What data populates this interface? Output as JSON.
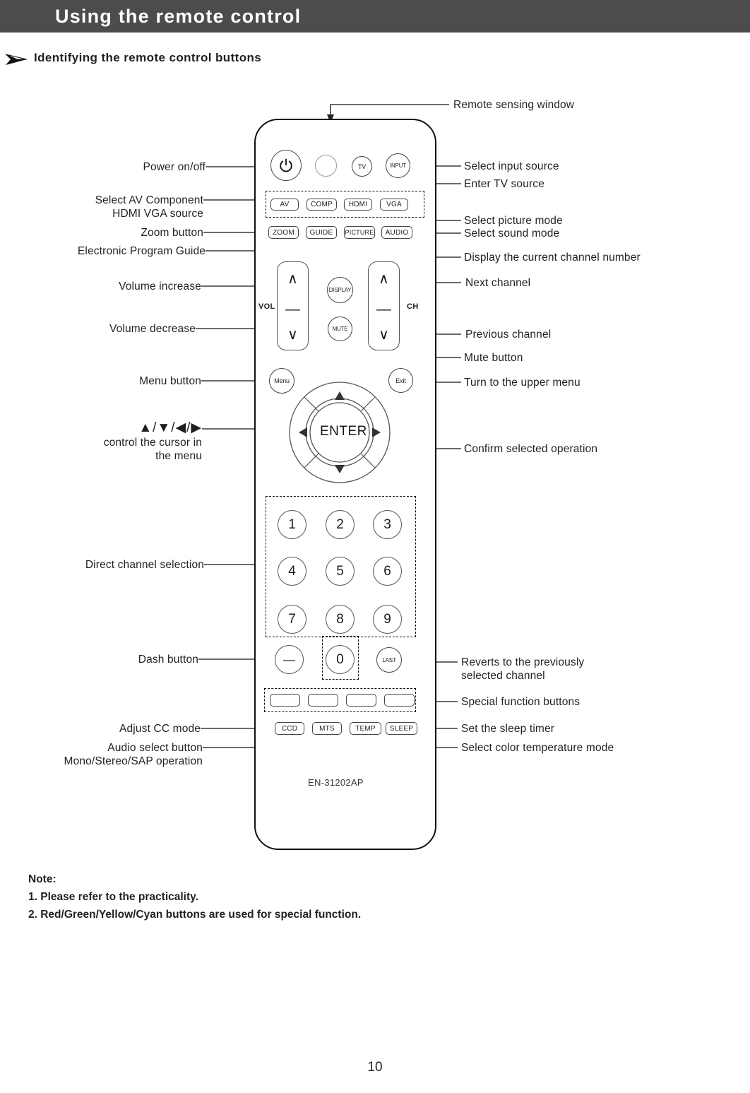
{
  "header": {
    "title": "Using the remote control"
  },
  "section": {
    "arrow_icon": "arrowhead-icon",
    "heading": "Identifying the remote control buttons"
  },
  "remote": {
    "model": "EN-31202AP",
    "top_buttons": [
      {
        "name": "power-button",
        "label": "⏻",
        "icon": "power-icon"
      },
      {
        "name": "led-indicator",
        "label": "",
        "icon": "led-icon"
      },
      {
        "name": "tv-button",
        "label": "TV"
      },
      {
        "name": "input-button",
        "label": "INPUT"
      }
    ],
    "source_buttons": [
      {
        "name": "av-button",
        "label": "AV"
      },
      {
        "name": "comp-button",
        "label": "COMP"
      },
      {
        "name": "hdmi-button",
        "label": "HDMI"
      },
      {
        "name": "vga-button",
        "label": "VGA"
      }
    ],
    "mode_buttons": [
      {
        "name": "zoom-button",
        "label": "ZOOM"
      },
      {
        "name": "guide-button",
        "label": "GUIDE"
      },
      {
        "name": "picture-button",
        "label": "PICTURE"
      },
      {
        "name": "audio-button",
        "label": "AUDIO"
      }
    ],
    "rockers": {
      "vol_label": "VOL",
      "ch_label": "CH",
      "up_glyph": "∧",
      "mid_glyph": "—",
      "down_glyph": "∨"
    },
    "center_round": [
      {
        "name": "display-button",
        "label": "DISPLAY"
      },
      {
        "name": "mute-button",
        "label": "MUTE"
      },
      {
        "name": "menu-button",
        "label": "Menu"
      },
      {
        "name": "exit-button",
        "label": "Exit"
      }
    ],
    "navpad": {
      "enter_label": "ENTER",
      "up_glyph": "▲",
      "down_glyph": "▼",
      "left_glyph": "◀",
      "right_glyph": "▶"
    },
    "numpad": [
      [
        "1",
        "2",
        "3"
      ],
      [
        "4",
        "5",
        "6"
      ],
      [
        "7",
        "8",
        "9"
      ]
    ],
    "bottom_row": [
      {
        "name": "dash-button",
        "label": "—"
      },
      {
        "name": "zero-button",
        "label": "0"
      },
      {
        "name": "last-button",
        "label": "LAST"
      }
    ],
    "color_buttons": [
      {
        "name": "red-function-button",
        "label": ""
      },
      {
        "name": "green-function-button",
        "label": ""
      },
      {
        "name": "yellow-function-button",
        "label": ""
      },
      {
        "name": "cyan-function-button",
        "label": ""
      }
    ],
    "function_buttons": [
      {
        "name": "ccd-button",
        "label": "CCD"
      },
      {
        "name": "mts-button",
        "label": "MTS"
      },
      {
        "name": "temp-button",
        "label": "TEMP"
      },
      {
        "name": "sleep-button",
        "label": "SLEEP"
      }
    ]
  },
  "callouts": {
    "left": [
      {
        "name": "callout-power",
        "lines": [
          "Power on/off"
        ]
      },
      {
        "name": "callout-source",
        "lines": [
          "Select AV Component",
          "HDMI VGA source"
        ]
      },
      {
        "name": "callout-zoom",
        "lines": [
          "Zoom button"
        ]
      },
      {
        "name": "callout-epg",
        "lines": [
          "Electronic Program Guide"
        ]
      },
      {
        "name": "callout-volume-up",
        "lines": [
          "Volume increase"
        ]
      },
      {
        "name": "callout-volume-down",
        "lines": [
          "Volume decrease"
        ]
      },
      {
        "name": "callout-menu",
        "lines": [
          "Menu button"
        ]
      },
      {
        "name": "callout-cursor",
        "lines": [
          "control the cursor in",
          "the menu"
        ]
      },
      {
        "name": "callout-direct-channel",
        "lines": [
          "Direct channel selection"
        ]
      },
      {
        "name": "callout-dash",
        "lines": [
          "Dash button"
        ]
      },
      {
        "name": "callout-cc",
        "lines": [
          "Adjust CC mode"
        ]
      },
      {
        "name": "callout-audio-select",
        "lines": [
          "Audio select button",
          "Mono/Stereo/SAP operation"
        ]
      }
    ],
    "right": [
      {
        "name": "callout-sensing-window",
        "lines": [
          "Remote sensing window"
        ]
      },
      {
        "name": "callout-input-source",
        "lines": [
          "Select input source"
        ]
      },
      {
        "name": "callout-tv-source",
        "lines": [
          "Enter TV source"
        ]
      },
      {
        "name": "callout-picture-mode",
        "lines": [
          "Select picture mode"
        ]
      },
      {
        "name": "callout-sound-mode",
        "lines": [
          "Select sound mode"
        ]
      },
      {
        "name": "callout-display-channel",
        "lines": [
          "Display the current channel number"
        ]
      },
      {
        "name": "callout-next-channel",
        "lines": [
          "Next channel"
        ]
      },
      {
        "name": "callout-previous-channel",
        "lines": [
          "Previous channel"
        ]
      },
      {
        "name": "callout-mute",
        "lines": [
          "Mute button"
        ]
      },
      {
        "name": "callout-upper-menu",
        "lines": [
          "Turn to the upper menu"
        ]
      },
      {
        "name": "callout-confirm",
        "lines": [
          "Confirm selected operation"
        ]
      },
      {
        "name": "callout-last-channel",
        "lines": [
          "Reverts to the previously",
          "selected channel"
        ]
      },
      {
        "name": "callout-special-function",
        "lines": [
          "Special function buttons"
        ]
      },
      {
        "name": "callout-sleep-timer",
        "lines": [
          "Set the sleep timer"
        ]
      },
      {
        "name": "callout-color-temp",
        "lines": [
          "Select color temperature mode"
        ]
      }
    ],
    "cursor_glyphs": "▲/▼/◀/▶"
  },
  "note": {
    "title": "Note:",
    "items": [
      "1. Please refer to the practicality.",
      "2. Red/Green/Yellow/Cyan buttons are used for special function."
    ]
  },
  "footer": {
    "page_number": "10"
  },
  "colors": {
    "banner": "#4d4b4c",
    "text": "#231f20",
    "line": "#555555"
  }
}
